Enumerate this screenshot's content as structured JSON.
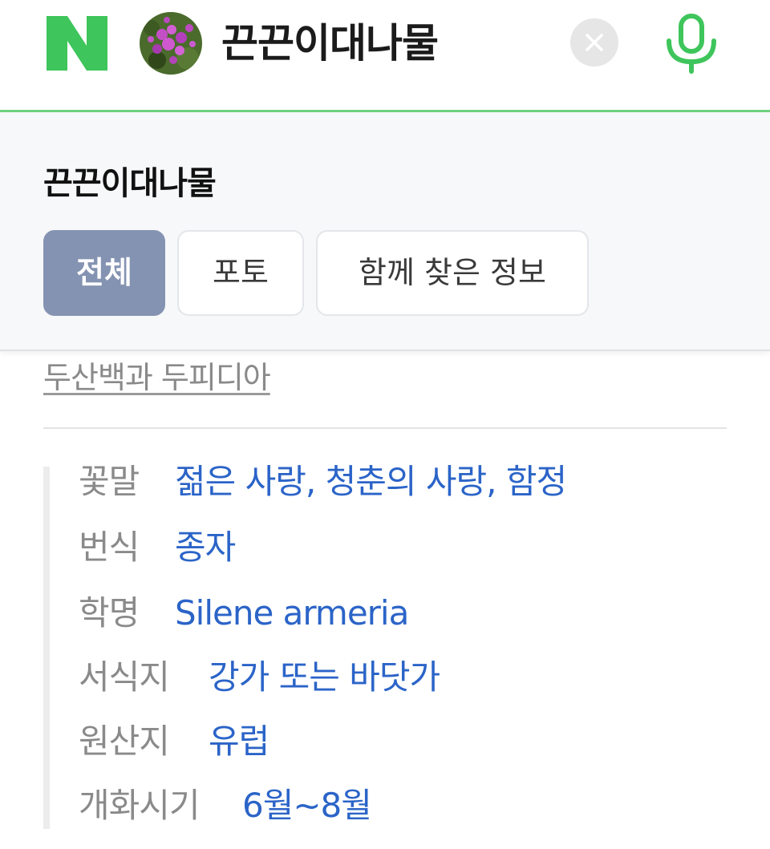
{
  "header": {
    "query": "끈끈이대나물",
    "logo_color": "#3ec55b",
    "accent_line_color": "#6fd27f",
    "mic_color": "#3ec55b"
  },
  "panel": {
    "title": "끈끈이대나물",
    "tabs": [
      {
        "label": "전체",
        "active": true
      },
      {
        "label": "포토",
        "active": false
      },
      {
        "label": "함께 찾은 정보",
        "active": false
      }
    ],
    "active_tab_color": "#8593b2"
  },
  "content": {
    "source": "두산백과 두피디아",
    "link_color": "#2b64c8",
    "info": [
      {
        "key": "꽃말",
        "value": "젊은 사랑, 청춘의 사랑, 함정"
      },
      {
        "key": "번식",
        "value": "종자"
      },
      {
        "key": "학명",
        "value": "Silene armeria"
      },
      {
        "key": "서식지",
        "value": "강가 또는 바닷가"
      },
      {
        "key": "원산지",
        "value": "유럽"
      },
      {
        "key": "개화시기",
        "value": "6월~8월"
      }
    ]
  }
}
